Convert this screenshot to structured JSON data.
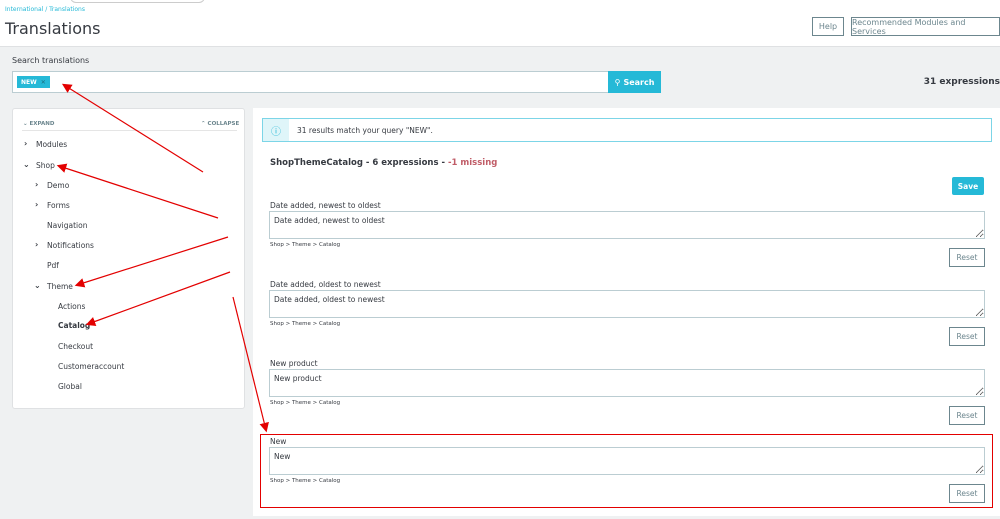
{
  "header": {
    "breadcrumb": "International / Translations",
    "title": "Translations",
    "help": "Help",
    "recommended": "Recommended Modules and Services"
  },
  "search": {
    "label": "Search translations",
    "tag": "NEW",
    "button": "Search",
    "count": "31 expressions"
  },
  "tree": {
    "expand": "EXPAND",
    "collapse": "COLLAPSE",
    "items": [
      {
        "label": "Modules"
      },
      {
        "label": "Shop"
      },
      {
        "label": "Demo"
      },
      {
        "label": "Forms"
      },
      {
        "label": "Navigation"
      },
      {
        "label": "Notifications"
      },
      {
        "label": "Pdf"
      },
      {
        "label": "Theme"
      },
      {
        "label": "Actions"
      },
      {
        "label": "Catalog"
      },
      {
        "label": "Checkout"
      },
      {
        "label": "Customeraccount"
      },
      {
        "label": "Global"
      }
    ]
  },
  "main": {
    "info": "31 results match your query \"NEW\".",
    "domain": "ShopThemeCatalog - 6 expressions - ",
    "missing": "-1 missing",
    "save": "Save",
    "items": [
      {
        "label": "Date added, newest to oldest",
        "value": "Date added, newest to oldest",
        "path": "Shop > Theme > Catalog",
        "reset": "Reset"
      },
      {
        "label": "Date added, oldest to newest",
        "value": "Date added, oldest to newest",
        "path": "Shop > Theme > Catalog",
        "reset": "Reset"
      },
      {
        "label": "New product",
        "value": "New product",
        "path": "Shop > Theme > Catalog",
        "reset": "Reset"
      },
      {
        "label": "New",
        "value": "New",
        "path": "Shop > Theme > Catalog",
        "reset": "Reset"
      }
    ]
  },
  "colors": {
    "accent": "#25b9d7",
    "annotation": "#e30000",
    "missing": "#c05c67"
  }
}
